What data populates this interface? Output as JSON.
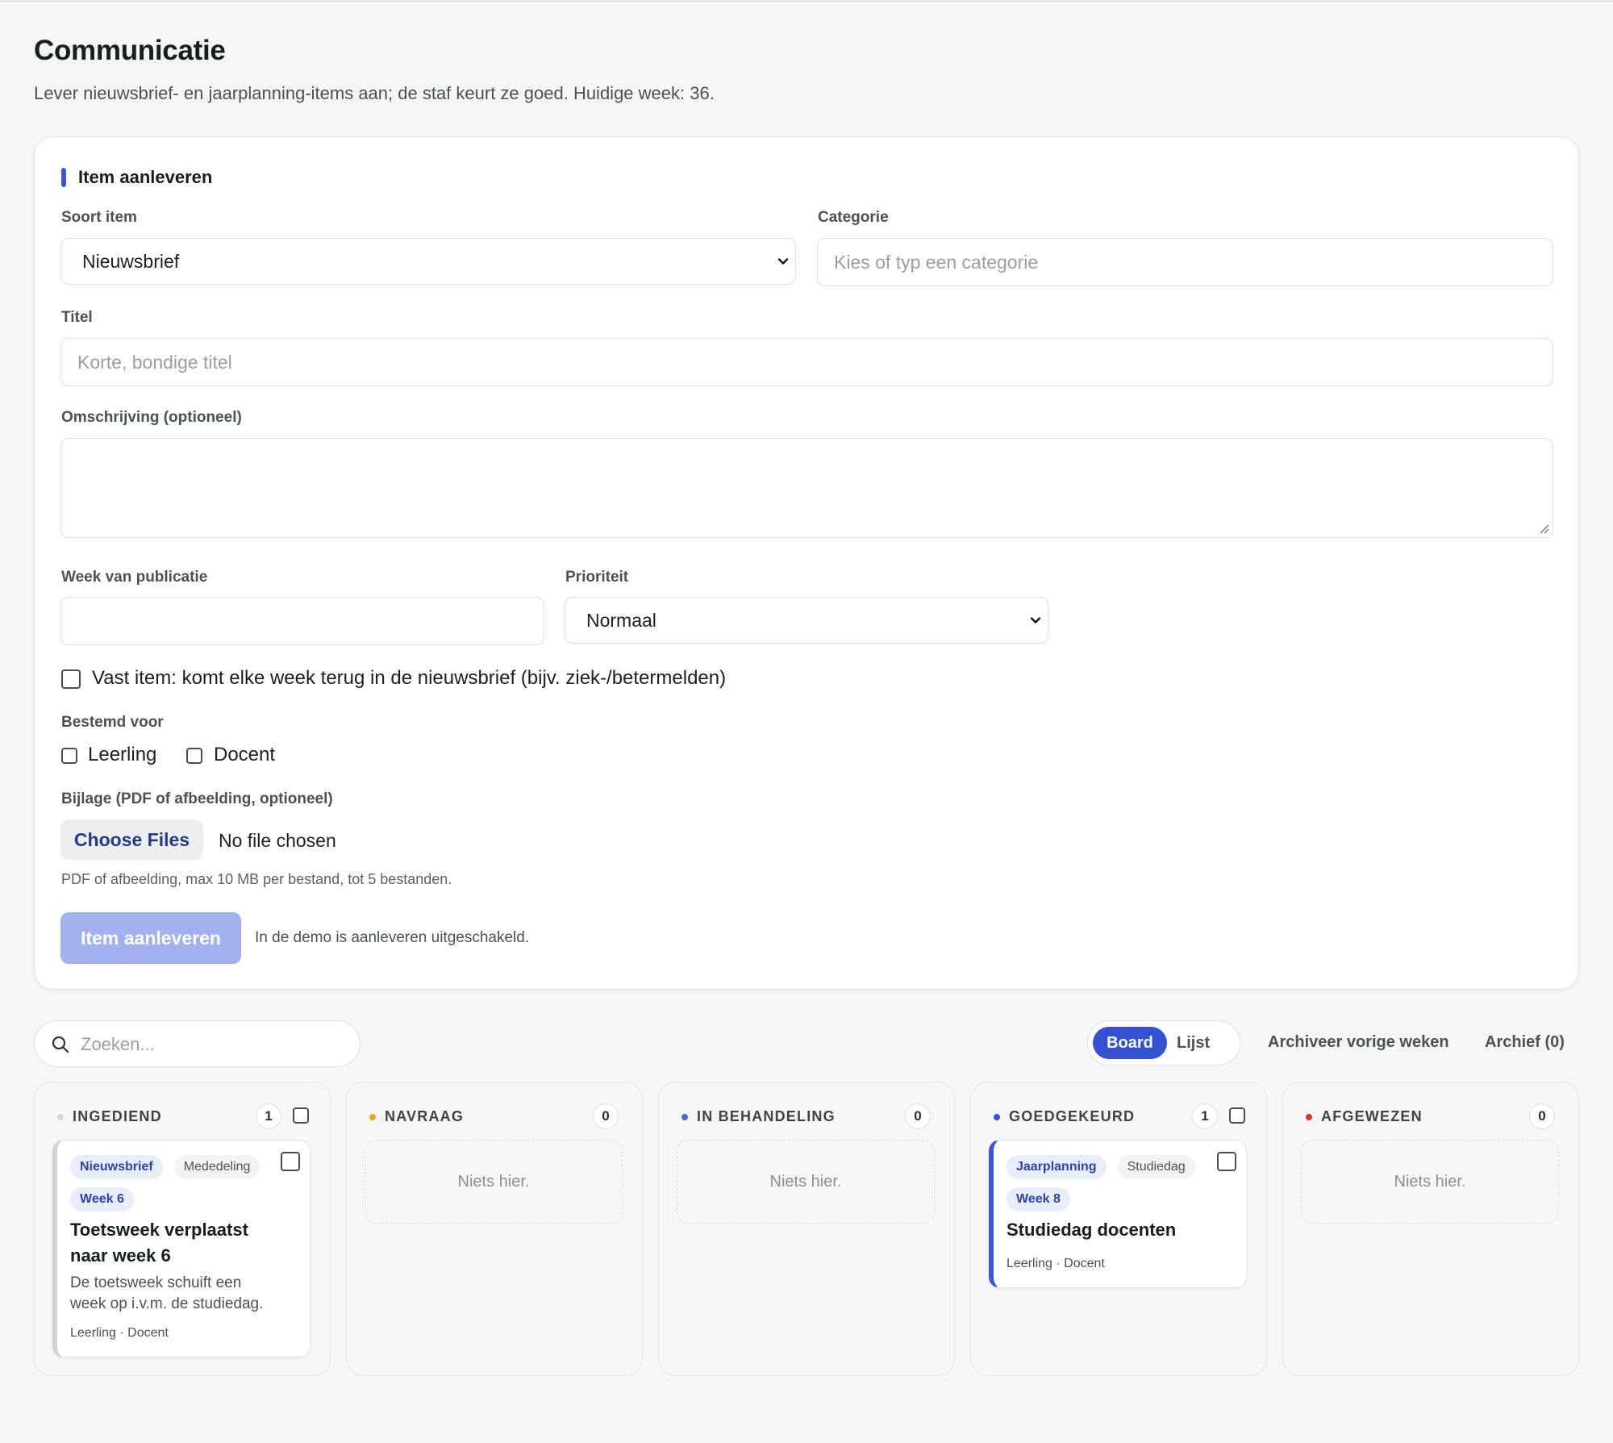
{
  "page": {
    "title": "Communicatie",
    "subtitle": "Lever nieuwsbrief- en jaarplanning-items aan; de staf keurt ze goed. Huidige week: 36."
  },
  "form": {
    "section_title": "Item aanleveren",
    "soort_label": "Soort item",
    "soort_value": "Nieuwsbrief",
    "categorie_label": "Categorie",
    "categorie_placeholder": "Kies of typ een categorie",
    "titel_label": "Titel",
    "titel_placeholder": "Korte, bondige titel",
    "omschrijving_label": "Omschrijving (optioneel)",
    "week_label": "Week van publicatie",
    "week_value": "",
    "prioriteit_label": "Prioriteit",
    "prioriteit_value": "Normaal",
    "vast_item_label": "Vast item: komt elke week terug in de nieuwsbrief (bijv. ziek-/betermelden)",
    "bestemd_label": "Bestemd voor",
    "leerling_label": "Leerling",
    "docent_label": "Docent",
    "bijlage_label": "Bijlage (PDF of afbeelding, optioneel)",
    "choose_files": "Choose Files",
    "no_file": "No file chosen",
    "bijlage_hint": "PDF of afbeelding, max 10 MB per bestand, tot 5 bestanden.",
    "submit_label": "Item aanleveren",
    "demo_note": "In de demo is aanleveren uitgeschakeld."
  },
  "toolbar": {
    "search_placeholder": "Zoeken...",
    "view_board": "Board",
    "view_list": "Lijst",
    "archive_prev": "Archiveer vorige weken",
    "archive": "Archief (0)"
  },
  "colors": {
    "accent": "#3451d1",
    "dot_ingediend": "#d5d8db",
    "dot_navraag": "#f0a020",
    "dot_behandeling": "#3a6fd8",
    "dot_goedgekeurd": "#3451d1",
    "dot_afgewezen": "#d9342b"
  },
  "board": {
    "empty_text": "Niets hier.",
    "columns": [
      {
        "title": "INGEDIEND",
        "count": "1",
        "card": {
          "tag_type": "Nieuwsbrief",
          "tag_category": "Mededeling",
          "tag_week": "Week 6",
          "title_line1": "Toetsweek verplaatst",
          "title_line2": "naar week 6",
          "desc_line1": "De toetsweek schuift een",
          "desc_line2": "week op i.v.m. de studiedag.",
          "meta": "Leerling · Docent"
        }
      },
      {
        "title": "NAVRAAG",
        "count": "0"
      },
      {
        "title": "IN BEHANDELING",
        "count": "0"
      },
      {
        "title": "GOEDGEKEURD",
        "count": "1",
        "card": {
          "tag_type": "Jaarplanning",
          "tag_category": "Studiedag",
          "tag_week": "Week 8",
          "title_line1": "Studiedag docenten",
          "meta": "Leerling · Docent"
        }
      },
      {
        "title": "AFGEWEZEN",
        "count": "0"
      }
    ]
  }
}
